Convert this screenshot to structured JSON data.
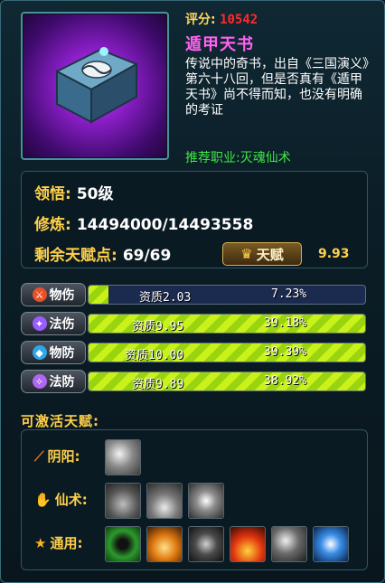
{
  "item": {
    "score_label": "评分:",
    "score_value": "10542",
    "name": "遁甲天书",
    "description": "传说中的奇书，出自《三国演义》第六十八回，但是否真有《遁甲天书》尚不得而知，也没有明确的考证",
    "recommended_job": "推荐职业:灭魂仙术"
  },
  "attributes": {
    "comprehension_label": "领悟:",
    "comprehension_value": "50级",
    "cultivation_label": "修炼:",
    "cultivation_value": "14494000/14493558",
    "talent_points_label": "剩余天赋点:",
    "talent_points_value": "69/69",
    "talent_button_label": "天赋",
    "talent_score": "9.93"
  },
  "stats": [
    {
      "name": "物伤",
      "quality": "资质2.03",
      "percent": "7.23%",
      "fill": 0.0723,
      "icon": "sword-icon",
      "icon_color": "#e8502a"
    },
    {
      "name": "法伤",
      "quality": "资质9.95",
      "percent": "39.18%",
      "fill": 1.0,
      "icon": "magic-icon",
      "icon_color": "#9a5cff"
    },
    {
      "name": "物防",
      "quality": "资质10.00",
      "percent": "39.39%",
      "fill": 1.0,
      "icon": "shield-icon",
      "icon_color": "#2fa6e8"
    },
    {
      "name": "法防",
      "quality": "资质9.89",
      "percent": "38.92%",
      "fill": 1.0,
      "icon": "magic-shield-icon",
      "icon_color": "#b066f0"
    }
  ],
  "activatable": {
    "title": "可激活天赋:",
    "categories": [
      {
        "label": "阴阳:",
        "icon": "yinyang-icon",
        "skills": [
          "skill-yinyang-1"
        ]
      },
      {
        "label": "仙术:",
        "icon": "immortal-art-icon",
        "skills": [
          "skill-immortal-1",
          "skill-immortal-2",
          "skill-immortal-3"
        ]
      },
      {
        "label": "通用:",
        "icon": "star-icon",
        "skills": [
          "skill-general-1",
          "skill-general-2",
          "skill-general-3",
          "skill-general-4",
          "skill-general-5",
          "skill-general-6"
        ]
      }
    ]
  },
  "colors": {
    "accent_gold": "#ffd04a",
    "item_name": "#ff62f0",
    "score": "#ff2a2a",
    "recommend": "#3fe844",
    "bar_fill": "#b4e818"
  }
}
